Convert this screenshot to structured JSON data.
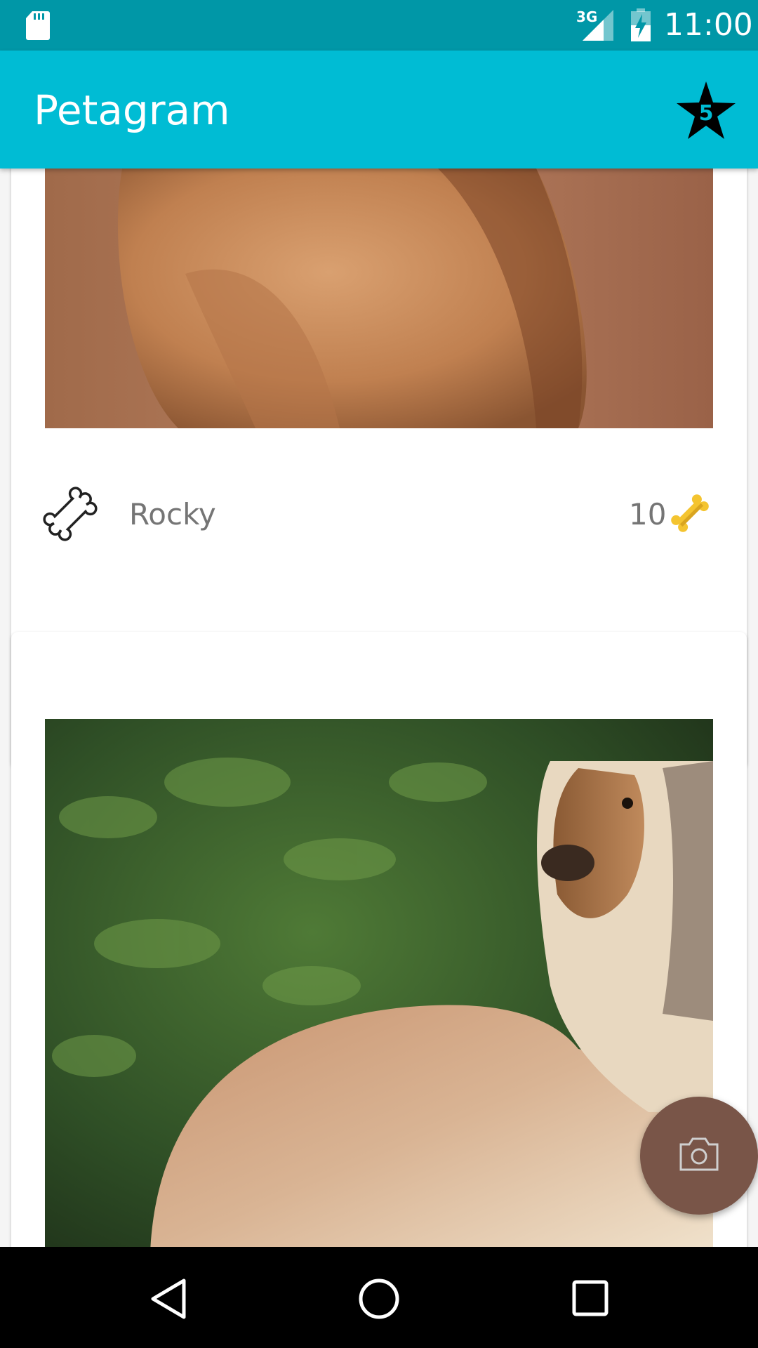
{
  "status_bar": {
    "time": "11:00",
    "network_label": "3G",
    "icons": [
      "sd-card-icon",
      "signal-icon",
      "battery-charging-icon"
    ]
  },
  "app_bar": {
    "title": "Petagram",
    "rank_badge_value": "5",
    "rank_icon": "star-icon"
  },
  "pets": [
    {
      "name": "Rocky",
      "likes": "10",
      "photo_icon": "cat-photo"
    },
    {
      "photo_icon": "afghan-hound-photo"
    }
  ],
  "fab": {
    "icon": "camera-icon",
    "color": "#795548"
  },
  "colors": {
    "primary": "#00bcd4",
    "primary_dark": "#0097a7",
    "accent": "#795548",
    "like_bone": "#f4c430"
  },
  "nav_bar": {
    "icons": [
      "back-icon",
      "home-icon",
      "recent-apps-icon"
    ]
  }
}
